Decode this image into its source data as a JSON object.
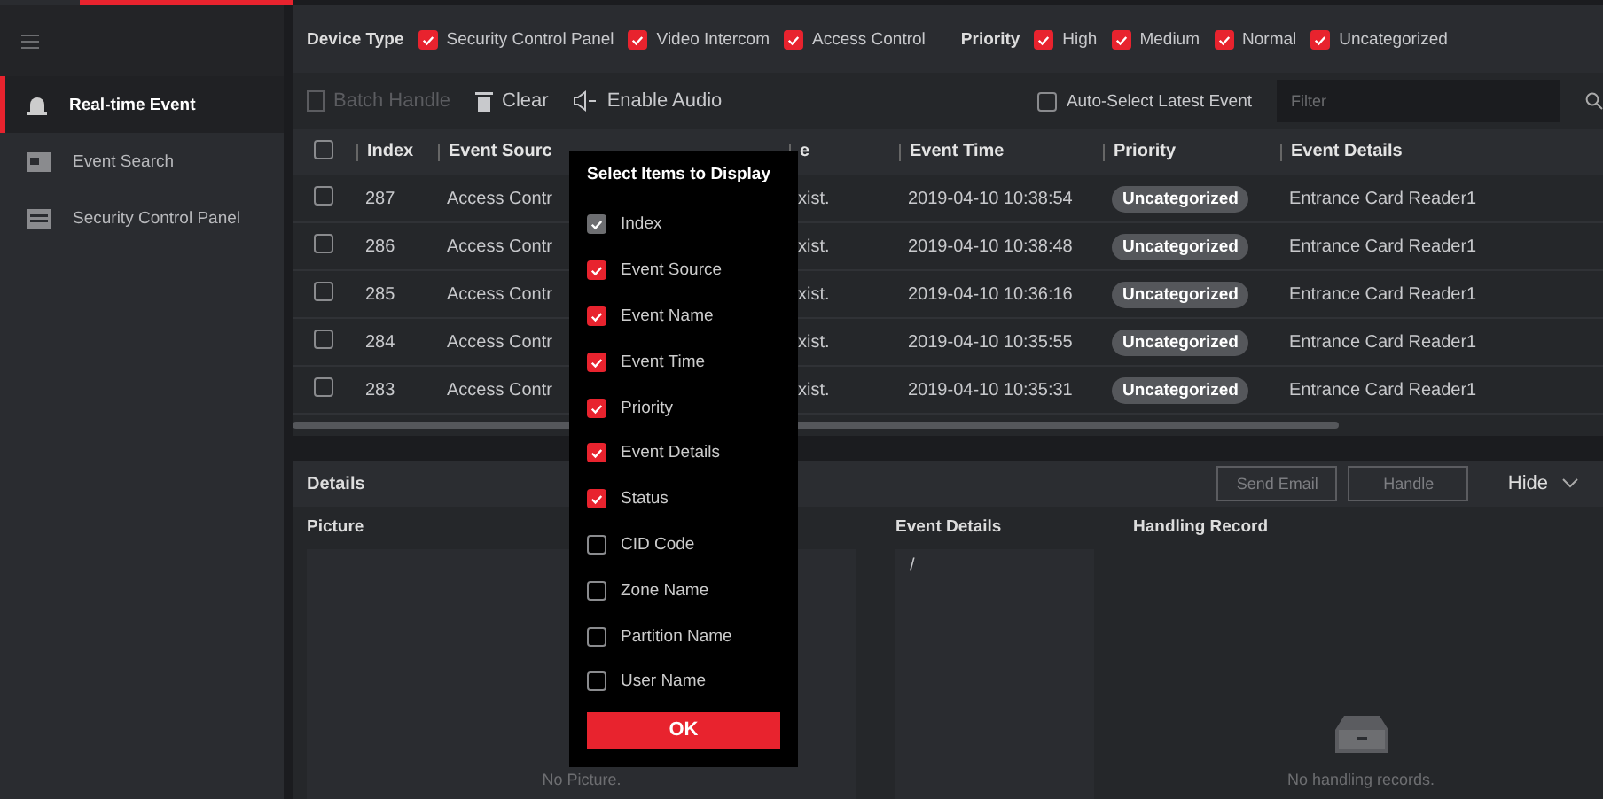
{
  "sidebar": {
    "items": [
      {
        "label": "Real-time Event",
        "selected": true
      },
      {
        "label": "Event Search",
        "selected": false
      },
      {
        "label": "Security Control Panel",
        "selected": false
      }
    ]
  },
  "filters": [
    {
      "title": "Device Type",
      "options": [
        {
          "label": "Security Control Panel",
          "checked": true
        },
        {
          "label": "Video Intercom",
          "checked": true
        },
        {
          "label": "Access Control",
          "checked": true
        }
      ]
    },
    {
      "title": "Priority",
      "options": [
        {
          "label": "High",
          "checked": true
        },
        {
          "label": "Medium",
          "checked": true
        },
        {
          "label": "Normal",
          "checked": true
        },
        {
          "label": "Uncategorized",
          "checked": true
        }
      ]
    }
  ],
  "toolbar": {
    "buttons": [
      {
        "label": "Batch Handle",
        "disabled": true
      },
      {
        "label": "Clear",
        "disabled": false
      },
      {
        "label": "Enable Audio",
        "disabled": false
      }
    ],
    "auto_select": {
      "label": "Auto-Select Latest Event",
      "checked": false
    },
    "filter": {
      "placeholder": "Filter"
    }
  },
  "table": {
    "select_all": {
      "checked": false
    },
    "columns": [
      "Index",
      "Event Sourc",
      "e",
      "Event Time",
      "Priority",
      "Event Details"
    ],
    "rows": [
      {
        "checked": false,
        "cells": [
          "287",
          "Access Contr",
          "xist.",
          "2019-04-10 10:38:54",
          "Uncategorized",
          "Entrance Card Reader1"
        ]
      },
      {
        "checked": false,
        "cells": [
          "286",
          "Access Contr",
          "xist.",
          "2019-04-10 10:38:48",
          "Uncategorized",
          "Entrance Card Reader1"
        ]
      },
      {
        "checked": false,
        "cells": [
          "285",
          "Access Contr",
          "xist.",
          "2019-04-10 10:36:16",
          "Uncategorized",
          "Entrance Card Reader1"
        ]
      },
      {
        "checked": false,
        "cells": [
          "284",
          "Access Contr",
          "xist.",
          "2019-04-10 10:35:55",
          "Uncategorized",
          "Entrance Card Reader1"
        ]
      },
      {
        "checked": false,
        "cells": [
          "283",
          "Access Contr",
          "xist.",
          "2019-04-10 10:35:31",
          "Uncategorized",
          "Entrance Card Reader1"
        ]
      }
    ]
  },
  "details": {
    "title": "Details",
    "buttons": [
      "Send Email",
      "Handle"
    ],
    "hide": "Hide",
    "picture": {
      "title": "Picture",
      "empty": "No Picture."
    },
    "event_details": {
      "title": "Event Details",
      "value": "/"
    },
    "handling_record": {
      "title": "Handling Record",
      "empty": "No handling records."
    }
  },
  "popup": {
    "title": "Select Items to Display",
    "items": [
      {
        "label": "Index",
        "checked": true,
        "disabled": true
      },
      {
        "label": "Event Source",
        "checked": true,
        "disabled": false
      },
      {
        "label": "Event Name",
        "checked": true,
        "disabled": false
      },
      {
        "label": "Event Time",
        "checked": true,
        "disabled": false
      },
      {
        "label": "Priority",
        "checked": true,
        "disabled": false
      },
      {
        "label": "Event Details",
        "checked": true,
        "disabled": false
      },
      {
        "label": "Status",
        "checked": true,
        "disabled": false
      },
      {
        "label": "CID Code",
        "checked": false,
        "disabled": false
      },
      {
        "label": "Zone Name",
        "checked": false,
        "disabled": false
      },
      {
        "label": "Partition Name",
        "checked": false,
        "disabled": false
      },
      {
        "label": "User Name",
        "checked": false,
        "disabled": false
      }
    ],
    "ok": "OK"
  }
}
